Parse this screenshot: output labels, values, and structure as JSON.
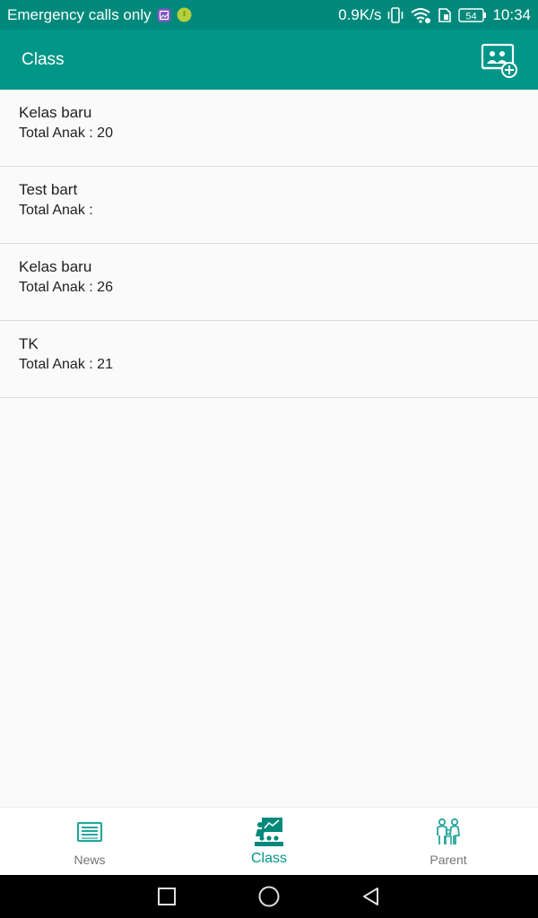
{
  "status_bar": {
    "carrier_text": "Emergency calls only",
    "net_speed": "0.9K/s",
    "battery": "54",
    "time": "10:34",
    "icons": [
      "gallery-icon",
      "android-icon",
      "vibrate-icon",
      "wifi-icon",
      "sim-icon",
      "battery-icon"
    ]
  },
  "app_bar": {
    "title": "Class",
    "action_icon": "add-class-icon"
  },
  "classes": [
    {
      "name": "Kelas baru",
      "total": "Total Anak : 20"
    },
    {
      "name": "Test bart",
      "total": "Total Anak :"
    },
    {
      "name": "Kelas baru",
      "total": "Total Anak : 26"
    },
    {
      "name": "TK",
      "total": "Total Anak : 21"
    }
  ],
  "bottom_nav": {
    "items": [
      {
        "label": "News",
        "icon": "news-icon",
        "active": false
      },
      {
        "label": "Class",
        "icon": "classroom-icon",
        "active": true
      },
      {
        "label": "Parent",
        "icon": "family-icon",
        "active": false
      }
    ]
  },
  "colors": {
    "primary": "#009688",
    "status_bar": "#00897b",
    "inactive_label": "#757575",
    "divider": "#dcdcdc"
  },
  "system_nav": [
    "recents-icon",
    "home-icon",
    "back-icon"
  ]
}
